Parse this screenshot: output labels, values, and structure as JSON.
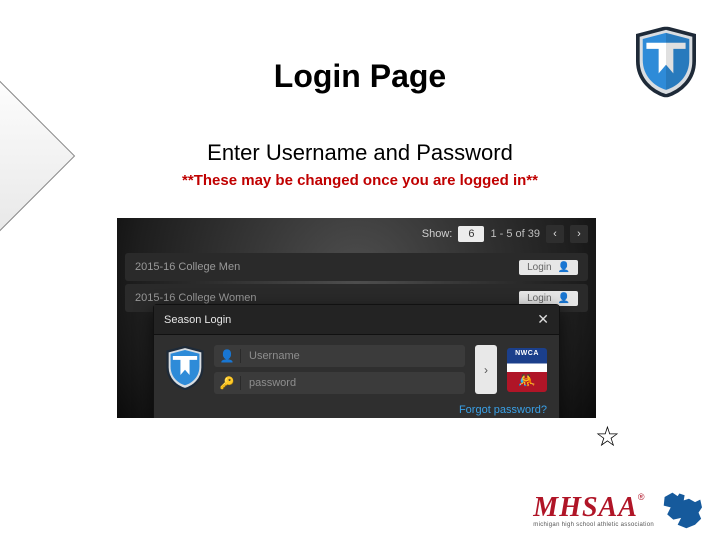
{
  "title": "Login Page",
  "subtitle": "Enter Username and Password",
  "note": "**These may be changed once you are logged in**",
  "panel": {
    "pager": {
      "show_label": "Show:",
      "page_size": "6",
      "range": "1 - 5 of 39",
      "prev": "‹",
      "next": "›"
    },
    "rows": [
      {
        "label": "2015-16 College Men",
        "action": "Login"
      },
      {
        "label": "2015-16 College Women",
        "action": "Login"
      }
    ],
    "modal": {
      "title": "Season Login",
      "close": "✕",
      "username_placeholder": "Username",
      "password_placeholder": "password",
      "submit": "›",
      "forgot": "Forgot password?",
      "badge_text": "NWCA"
    }
  },
  "star": "☆",
  "footer": {
    "brand": "MHSAA",
    "reg": "®",
    "tagline": "michigan high school athletic association"
  }
}
